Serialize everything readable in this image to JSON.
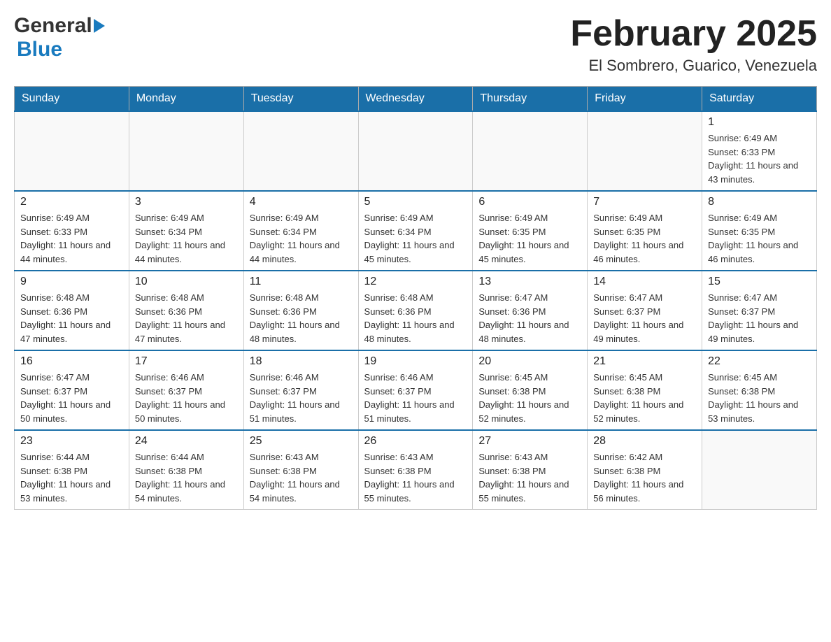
{
  "header": {
    "logo": {
      "general": "General",
      "blue": "Blue",
      "triangle_alt": "logo triangle"
    },
    "title": "February 2025",
    "location": "El Sombrero, Guarico, Venezuela"
  },
  "calendar": {
    "days_of_week": [
      "Sunday",
      "Monday",
      "Tuesday",
      "Wednesday",
      "Thursday",
      "Friday",
      "Saturday"
    ],
    "weeks": [
      [
        {
          "day": "",
          "info": ""
        },
        {
          "day": "",
          "info": ""
        },
        {
          "day": "",
          "info": ""
        },
        {
          "day": "",
          "info": ""
        },
        {
          "day": "",
          "info": ""
        },
        {
          "day": "",
          "info": ""
        },
        {
          "day": "1",
          "info": "Sunrise: 6:49 AM\nSunset: 6:33 PM\nDaylight: 11 hours and 43 minutes."
        }
      ],
      [
        {
          "day": "2",
          "info": "Sunrise: 6:49 AM\nSunset: 6:33 PM\nDaylight: 11 hours and 44 minutes."
        },
        {
          "day": "3",
          "info": "Sunrise: 6:49 AM\nSunset: 6:34 PM\nDaylight: 11 hours and 44 minutes."
        },
        {
          "day": "4",
          "info": "Sunrise: 6:49 AM\nSunset: 6:34 PM\nDaylight: 11 hours and 44 minutes."
        },
        {
          "day": "5",
          "info": "Sunrise: 6:49 AM\nSunset: 6:34 PM\nDaylight: 11 hours and 45 minutes."
        },
        {
          "day": "6",
          "info": "Sunrise: 6:49 AM\nSunset: 6:35 PM\nDaylight: 11 hours and 45 minutes."
        },
        {
          "day": "7",
          "info": "Sunrise: 6:49 AM\nSunset: 6:35 PM\nDaylight: 11 hours and 46 minutes."
        },
        {
          "day": "8",
          "info": "Sunrise: 6:49 AM\nSunset: 6:35 PM\nDaylight: 11 hours and 46 minutes."
        }
      ],
      [
        {
          "day": "9",
          "info": "Sunrise: 6:48 AM\nSunset: 6:36 PM\nDaylight: 11 hours and 47 minutes."
        },
        {
          "day": "10",
          "info": "Sunrise: 6:48 AM\nSunset: 6:36 PM\nDaylight: 11 hours and 47 minutes."
        },
        {
          "day": "11",
          "info": "Sunrise: 6:48 AM\nSunset: 6:36 PM\nDaylight: 11 hours and 48 minutes."
        },
        {
          "day": "12",
          "info": "Sunrise: 6:48 AM\nSunset: 6:36 PM\nDaylight: 11 hours and 48 minutes."
        },
        {
          "day": "13",
          "info": "Sunrise: 6:47 AM\nSunset: 6:36 PM\nDaylight: 11 hours and 48 minutes."
        },
        {
          "day": "14",
          "info": "Sunrise: 6:47 AM\nSunset: 6:37 PM\nDaylight: 11 hours and 49 minutes."
        },
        {
          "day": "15",
          "info": "Sunrise: 6:47 AM\nSunset: 6:37 PM\nDaylight: 11 hours and 49 minutes."
        }
      ],
      [
        {
          "day": "16",
          "info": "Sunrise: 6:47 AM\nSunset: 6:37 PM\nDaylight: 11 hours and 50 minutes."
        },
        {
          "day": "17",
          "info": "Sunrise: 6:46 AM\nSunset: 6:37 PM\nDaylight: 11 hours and 50 minutes."
        },
        {
          "day": "18",
          "info": "Sunrise: 6:46 AM\nSunset: 6:37 PM\nDaylight: 11 hours and 51 minutes."
        },
        {
          "day": "19",
          "info": "Sunrise: 6:46 AM\nSunset: 6:37 PM\nDaylight: 11 hours and 51 minutes."
        },
        {
          "day": "20",
          "info": "Sunrise: 6:45 AM\nSunset: 6:38 PM\nDaylight: 11 hours and 52 minutes."
        },
        {
          "day": "21",
          "info": "Sunrise: 6:45 AM\nSunset: 6:38 PM\nDaylight: 11 hours and 52 minutes."
        },
        {
          "day": "22",
          "info": "Sunrise: 6:45 AM\nSunset: 6:38 PM\nDaylight: 11 hours and 53 minutes."
        }
      ],
      [
        {
          "day": "23",
          "info": "Sunrise: 6:44 AM\nSunset: 6:38 PM\nDaylight: 11 hours and 53 minutes."
        },
        {
          "day": "24",
          "info": "Sunrise: 6:44 AM\nSunset: 6:38 PM\nDaylight: 11 hours and 54 minutes."
        },
        {
          "day": "25",
          "info": "Sunrise: 6:43 AM\nSunset: 6:38 PM\nDaylight: 11 hours and 54 minutes."
        },
        {
          "day": "26",
          "info": "Sunrise: 6:43 AM\nSunset: 6:38 PM\nDaylight: 11 hours and 55 minutes."
        },
        {
          "day": "27",
          "info": "Sunrise: 6:43 AM\nSunset: 6:38 PM\nDaylight: 11 hours and 55 minutes."
        },
        {
          "day": "28",
          "info": "Sunrise: 6:42 AM\nSunset: 6:38 PM\nDaylight: 11 hours and 56 minutes."
        },
        {
          "day": "",
          "info": ""
        }
      ]
    ]
  }
}
